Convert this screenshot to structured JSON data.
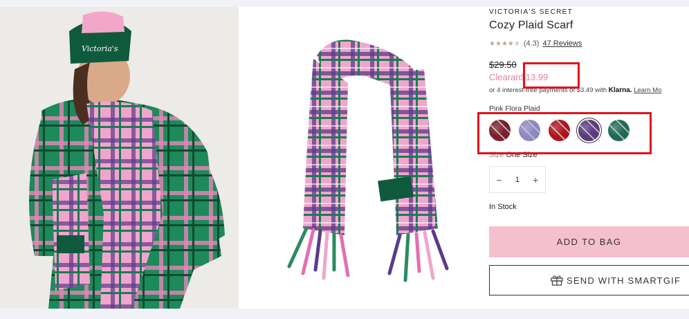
{
  "product": {
    "brand": "VICTORIA'S SECRET",
    "title": "Cozy Plaid Scarf",
    "rating_value": 4.3,
    "rating_text": "(4.3)",
    "reviews": "47 Reviews",
    "original_price": "$29.50",
    "sale_prefix": "Clearan",
    "sale_price": "$13.99",
    "klarna_prefix": "or 4 interest-free payments of $3.49 with",
    "klarna_brand": "Klarna.",
    "learn_more": "Learn Mo",
    "color_label": "Pink Flora Plaid",
    "size_label": "Size",
    "size_value": "One Size",
    "quantity": "1",
    "stock": "In Stock",
    "add_to_bag": "ADD TO BAG",
    "smartgift": "SEND WITH SMARTGIF"
  },
  "swatches": [
    {
      "name": "red-black-plaid",
      "color": "#7a1f2b"
    },
    {
      "name": "blue-pink-plaid",
      "color": "#8c88c2"
    },
    {
      "name": "red-plaid",
      "color": "#b0131e"
    },
    {
      "name": "pink-flora-plaid",
      "color": "#5b3a7e",
      "selected": true
    },
    {
      "name": "green-plaid",
      "color": "#1f6a55"
    }
  ],
  "colors": {
    "sale": "#e77fa3",
    "add_to_bag_bg": "#f5c0cd",
    "annotation": "#e4101a",
    "plaid_pink": "#e9a2c7",
    "plaid_green": "#1a8a5b",
    "plaid_purple": "#6a3d87"
  }
}
